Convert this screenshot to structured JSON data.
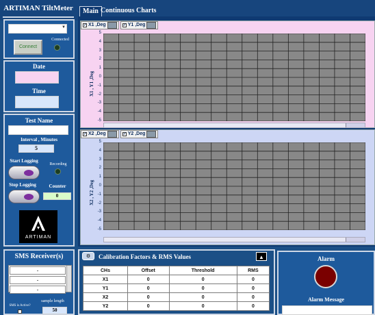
{
  "app": {
    "title": "ARTIMAN TiltMeter"
  },
  "tabs": [
    {
      "label": "Main"
    },
    {
      "label": "Continuous Charts"
    }
  ],
  "connection": {
    "port_value": "",
    "connect_label": "Connect",
    "connected_label": "Connected"
  },
  "datetime": {
    "date_label": "Date",
    "date_value": "",
    "time_label": "Time",
    "time_value": ""
  },
  "logging": {
    "test_name_label": "Test Name",
    "test_name_value": "",
    "interval_label": "Interval , Minutes",
    "interval_value": "5",
    "start_label": "Start Logging",
    "recording_label": "Recording",
    "stop_label": "Stop Logging",
    "counter_label": "Counter",
    "counter_value": "0"
  },
  "logo": {
    "text": "ARTIMAN"
  },
  "chart1": {
    "legend": [
      {
        "label": "X1 ,Deg"
      },
      {
        "label": "Y1 ,Deg"
      }
    ],
    "ylabel": "X1 , Y1 ,Deg",
    "ticks": [
      "5",
      "4",
      "3",
      "2",
      "1",
      "0",
      "-1",
      "-2",
      "-3",
      "-4",
      "-5"
    ]
  },
  "chart2": {
    "legend": [
      {
        "label": "X2 ,Deg"
      },
      {
        "label": "Y2 ,Deg"
      }
    ],
    "ylabel": "X2 , Y2 ,Deg",
    "ticks": [
      "5",
      "4",
      "3",
      "2",
      "1",
      "0",
      "-1",
      "-2",
      "-3",
      "-4",
      "-5"
    ]
  },
  "sms": {
    "title": "SMS Receiver(s)",
    "rows": [
      "-",
      "-",
      "-"
    ],
    "active_label": "SMS is Active?",
    "sample_length_label": "sample length",
    "sample_length_value": "50"
  },
  "calibration": {
    "title": "Calibration Factors & RMS Values",
    "headers": [
      "CHs",
      "Offset",
      "Threshold",
      "RMS"
    ],
    "rows": [
      [
        "X1",
        "0",
        "0",
        "0"
      ],
      [
        "Y1",
        "0",
        "0",
        "0"
      ],
      [
        "X2",
        "0",
        "0",
        "0"
      ],
      [
        "Y2",
        "0",
        "0",
        "0"
      ]
    ]
  },
  "alarm": {
    "title": "Alarm",
    "message_label": "Alarm Message",
    "lamp_color": "#7a0000"
  },
  "colors": {
    "background": "#1b4f86",
    "panel": "#1e5a9c",
    "chart_bg_pink": "#f7d3f1",
    "chart_bg_blue": "#cdd6f5",
    "plot": "#888888"
  }
}
